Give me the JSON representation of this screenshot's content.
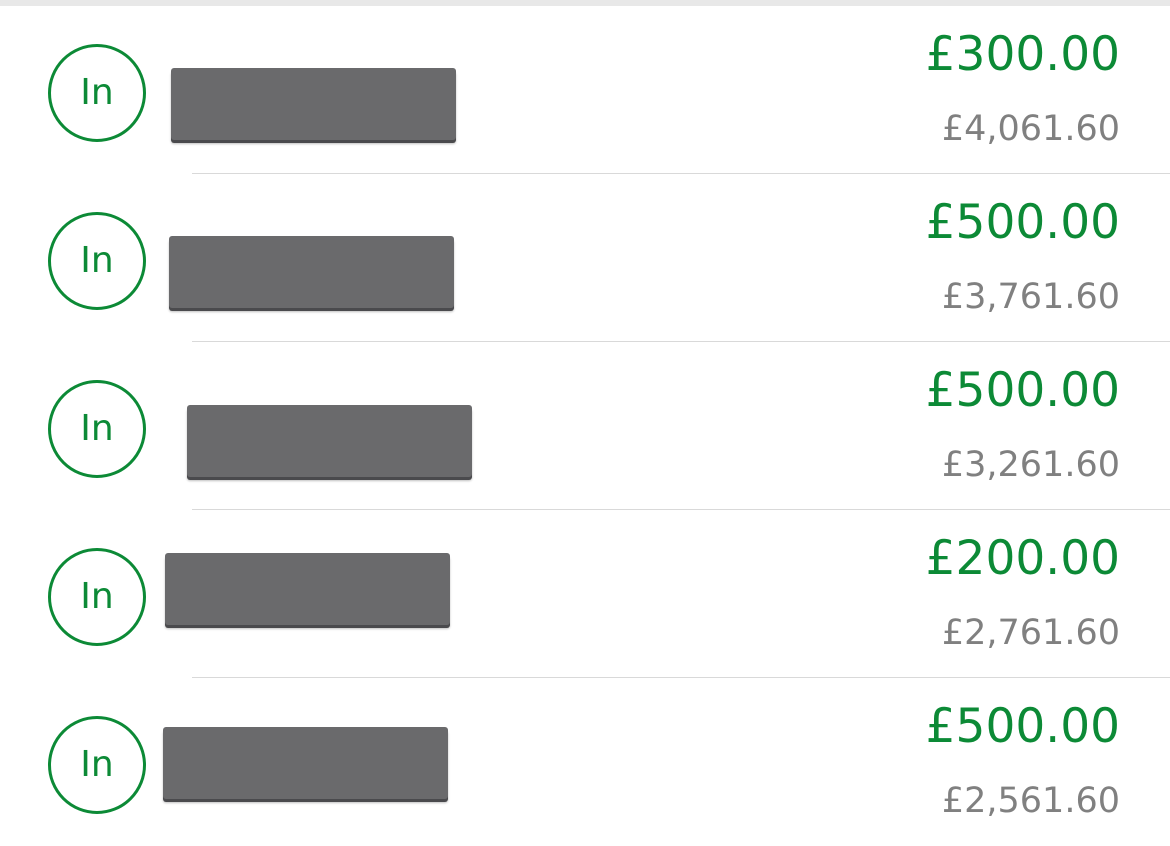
{
  "transactions": [
    {
      "direction_label": "In",
      "amount": "£300.00",
      "balance": "£4,061.60"
    },
    {
      "direction_label": "In",
      "amount": "£500.00",
      "balance": "£3,761.60"
    },
    {
      "direction_label": "In",
      "amount": "£500.00",
      "balance": "£3,261.60"
    },
    {
      "direction_label": "In",
      "amount": "£200.00",
      "balance": "£2,761.60"
    },
    {
      "direction_label": "In",
      "amount": "£500.00",
      "balance": "£2,561.60"
    }
  ],
  "colors": {
    "incoming_green": "#0c8a36",
    "balance_grey": "#808080",
    "redaction_grey": "#6a6a6c",
    "divider": "#d9d9d9"
  },
  "icons": {
    "direction_badge": "in-badge-circle"
  }
}
